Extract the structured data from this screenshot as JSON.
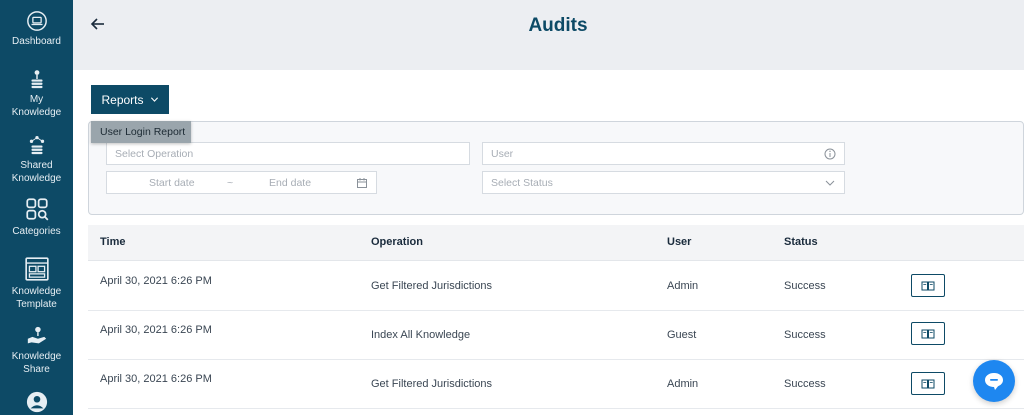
{
  "sidebar": {
    "items": [
      {
        "label": "Dashboard",
        "icon": "laptop-icon"
      },
      {
        "label": "My Knowledge",
        "icon": "knowledge-stack-icon"
      },
      {
        "label": "Shared Knowledge",
        "icon": "shared-knowledge-icon"
      },
      {
        "label": "Categories",
        "icon": "categories-grid-icon"
      },
      {
        "label": "Knowledge Template",
        "icon": "template-icon"
      },
      {
        "label": "Knowledge Share",
        "icon": "hand-share-icon"
      },
      {
        "label": "",
        "icon": "user-avatar-icon"
      }
    ]
  },
  "header": {
    "title": "Audits",
    "back_icon": "arrow-left-icon"
  },
  "reports": {
    "label": "Reports",
    "menu": [
      "User Login Report"
    ]
  },
  "filters": {
    "operation_placeholder": "Select Operation",
    "user_placeholder": "User",
    "start_date_placeholder": "Start date",
    "date_separator": "~",
    "end_date_placeholder": "End date",
    "status_placeholder": "Select Status"
  },
  "table": {
    "columns": [
      "Time",
      "Operation",
      "User",
      "Status"
    ],
    "rows": [
      {
        "time": "April 30, 2021 6:26 PM",
        "operation": "Get Filtered Jurisdictions",
        "user": "Admin",
        "status": "Success"
      },
      {
        "time": "April 30, 2021 6:26 PM",
        "operation": "Index All Knowledge",
        "user": "Guest",
        "status": "Success"
      },
      {
        "time": "April 30, 2021 6:26 PM",
        "operation": "Get Filtered Jurisdictions",
        "user": "Admin",
        "status": "Success"
      }
    ]
  },
  "colors": {
    "primary": "#0d4a66",
    "chat": "#1e87f0",
    "header_bg": "#eceef2"
  }
}
